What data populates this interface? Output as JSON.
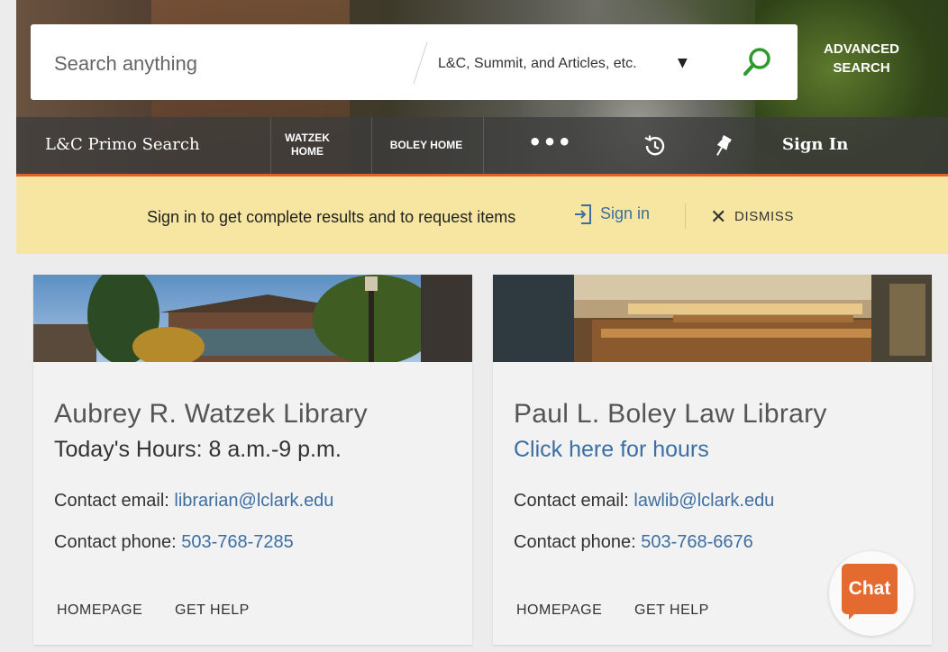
{
  "search": {
    "placeholder": "Search anything",
    "scope": "L&C, Summit, and Articles, etc.",
    "advanced_line1": "ADVANCED",
    "advanced_line2": "SEARCH"
  },
  "nav": {
    "brand": "L&C Primo Search",
    "watzek_line1": "WATZEK",
    "watzek_line2": "HOME",
    "boley": "BOLEY HOME",
    "more": "•••",
    "sign_in": "Sign In",
    "icons": [
      "history-icon",
      "pin-icon"
    ]
  },
  "banner": {
    "message": "Sign in to get complete results and to request items",
    "sign_in": "Sign in",
    "dismiss": "DISMISS"
  },
  "cards": [
    {
      "title": "Aubrey R. Watzek Library",
      "hours": "Today's Hours: 8 a.m.-9 p.m.",
      "email_label": "Contact email: ",
      "email": "librarian@lclark.edu",
      "phone_label": "Contact phone: ",
      "phone": "503-768-7285",
      "homepage": "HOMEPAGE",
      "help": "GET HELP"
    },
    {
      "title": "Paul L. Boley Law Library",
      "hours": "Click here for hours",
      "email_label": "Contact email: ",
      "email": "lawlib@lclark.edu",
      "phone_label": "Contact phone: ",
      "phone": "503-768-6676",
      "homepage": "HOMEPAGE",
      "help": "GET HELP"
    }
  ],
  "chat": {
    "label": "Chat"
  },
  "colors": {
    "accent": "#e35f2c",
    "link": "#3d6ea1",
    "search_icon": "#2e9a2e",
    "banner_bg": "#f6e6a1",
    "chat": "#e56a2f"
  }
}
